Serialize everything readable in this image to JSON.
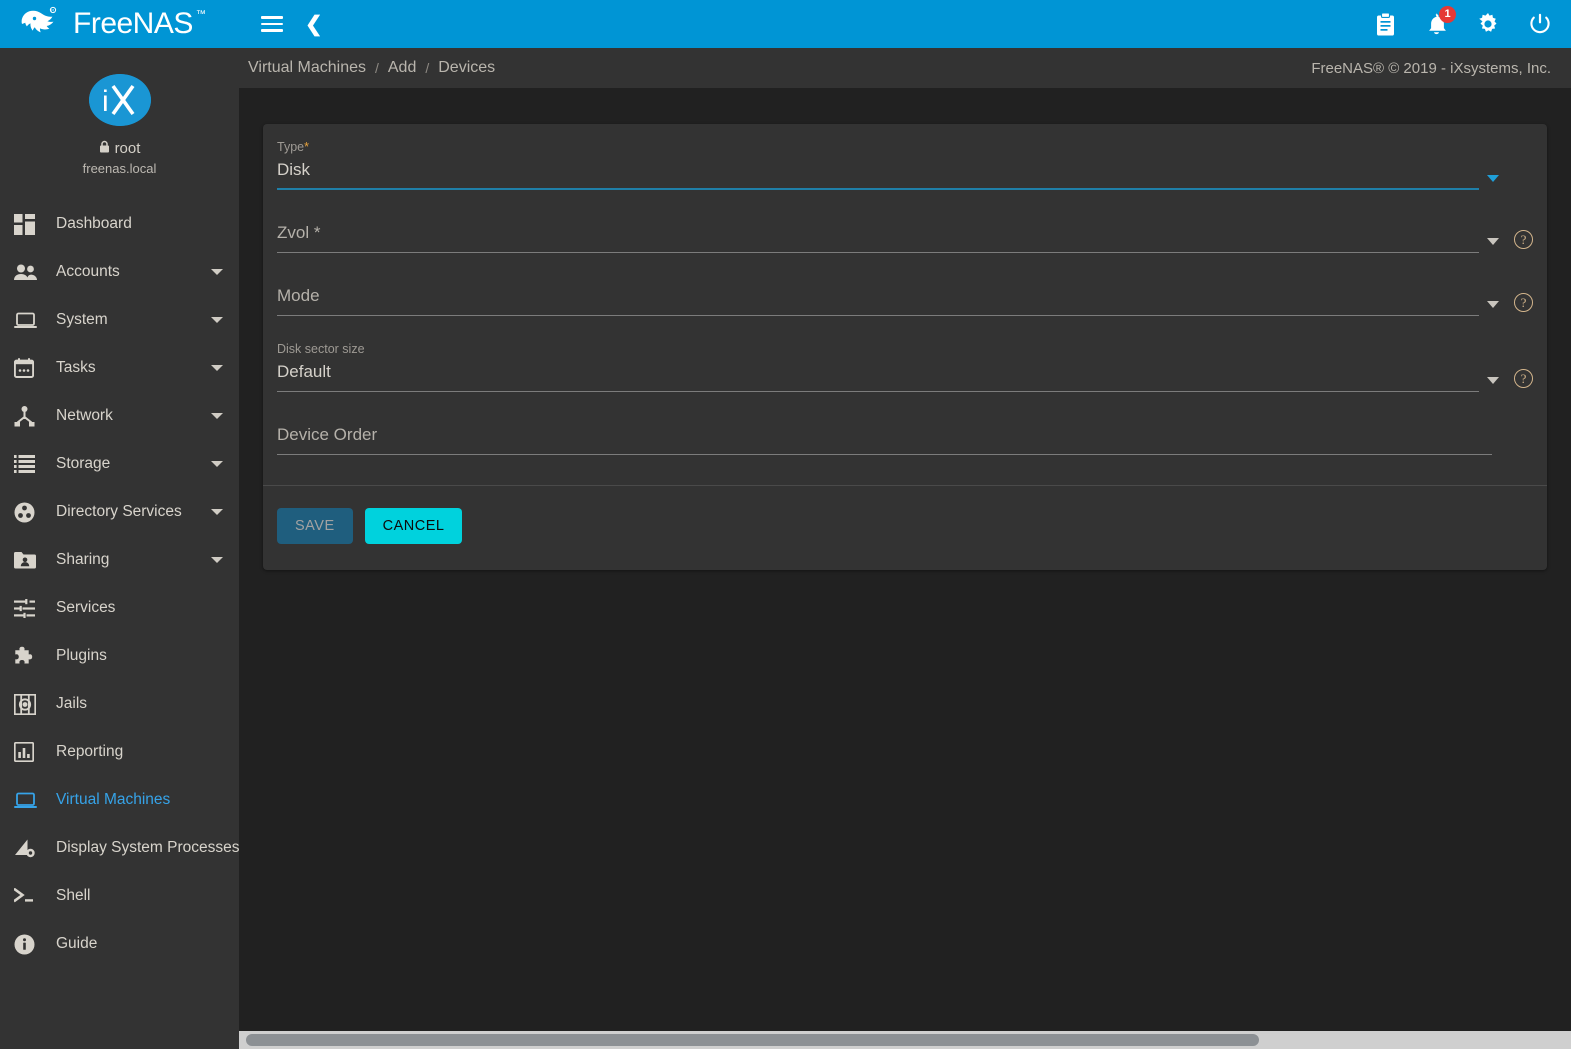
{
  "brand": {
    "name": "FreeNAS",
    "tm": "™",
    "logo_icon": "freenas-fish-logo"
  },
  "sidebar": {
    "user": {
      "avatar_text": "iX",
      "lock_icon": "lock-icon",
      "username": "root",
      "hostname": "freenas.local"
    },
    "items": [
      {
        "label": "Dashboard",
        "icon": "dashboard-icon",
        "expandable": false,
        "active": false
      },
      {
        "label": "Accounts",
        "icon": "accounts-people-icon",
        "expandable": true,
        "active": false
      },
      {
        "label": "System",
        "icon": "system-laptop-icon",
        "expandable": true,
        "active": false
      },
      {
        "label": "Tasks",
        "icon": "tasks-calendar-icon",
        "expandable": true,
        "active": false
      },
      {
        "label": "Network",
        "icon": "network-nodes-icon",
        "expandable": true,
        "active": false
      },
      {
        "label": "Storage",
        "icon": "storage-stack-icon",
        "expandable": true,
        "active": false
      },
      {
        "label": "Directory Services",
        "icon": "directory-services-icon",
        "expandable": true,
        "active": false
      },
      {
        "label": "Sharing",
        "icon": "sharing-folder-icon",
        "expandable": true,
        "active": false
      },
      {
        "label": "Services",
        "icon": "services-sliders-icon",
        "expandable": false,
        "active": false
      },
      {
        "label": "Plugins",
        "icon": "plugins-puzzle-icon",
        "expandable": false,
        "active": false
      },
      {
        "label": "Jails",
        "icon": "jails-icon",
        "expandable": false,
        "active": false
      },
      {
        "label": "Reporting",
        "icon": "reporting-chart-icon",
        "expandable": false,
        "active": false
      },
      {
        "label": "Virtual Machines",
        "icon": "virtual-machines-laptop-icon",
        "expandable": false,
        "active": true
      },
      {
        "label": "Display System Processes",
        "icon": "display-system-processes-icon",
        "expandable": false,
        "active": false
      },
      {
        "label": "Shell",
        "icon": "shell-prompt-icon",
        "expandable": false,
        "active": false
      },
      {
        "label": "Guide",
        "icon": "guide-info-icon",
        "expandable": false,
        "active": false
      }
    ]
  },
  "topbar": {
    "menu_icon": "hamburger-menu-icon",
    "back_icon": "chevron-left-icon",
    "actions": [
      {
        "icon": "clipboard-tasks-icon",
        "badge": null
      },
      {
        "icon": "notifications-bell-icon",
        "badge": "1"
      },
      {
        "icon": "settings-gear-icon",
        "badge": null
      },
      {
        "icon": "power-icon",
        "badge": null
      }
    ]
  },
  "breadcrumb": {
    "items": [
      "Virtual Machines",
      "Add",
      "Devices"
    ],
    "separator": "/"
  },
  "footer": {
    "copyright": "FreeNAS® © 2019 - iXsystems, Inc."
  },
  "form": {
    "fields": [
      {
        "name": "type",
        "label": "Type",
        "required_mark": "*",
        "value": "Disk",
        "state": "filled-focused",
        "has_arrow": true,
        "arrow_color": "#1f9fd8",
        "has_help": false
      },
      {
        "name": "zvol",
        "label": "Zvol *",
        "required_mark": "",
        "value": "",
        "state": "empty",
        "has_arrow": true,
        "arrow_color": "#c9c5be",
        "has_help": true,
        "help_icon": "help-circle-icon"
      },
      {
        "name": "mode",
        "label": "Mode",
        "required_mark": "",
        "value": "",
        "state": "empty",
        "has_arrow": true,
        "arrow_color": "#c9c5be",
        "has_help": true,
        "help_icon": "help-circle-icon"
      },
      {
        "name": "disk-sector-size",
        "label": "Disk sector size",
        "required_mark": "",
        "value": "Default",
        "state": "filled",
        "has_arrow": true,
        "arrow_color": "#c9c5be",
        "has_help": true,
        "help_icon": "help-circle-icon"
      },
      {
        "name": "device-order",
        "label": "Device Order",
        "required_mark": "",
        "value": "",
        "state": "empty",
        "has_arrow": false,
        "arrow_color": "",
        "has_help": false
      }
    ],
    "buttons": {
      "save": "SAVE",
      "cancel": "CANCEL"
    }
  },
  "colors": {
    "brand_blue": "#0095d5",
    "accent_cyan": "#00d2dd",
    "active_nav": "#36a3e8",
    "required_star": "#e8a33d",
    "badge_red": "#e53935",
    "sidebar_bg": "#333333",
    "page_bg": "#212121",
    "card_bg": "#333333",
    "focused_underline": "#1f7fa8",
    "help_icon": "#d3b58c",
    "save_disabled_bg": "#1f5e7e"
  },
  "scrollbar": {
    "orientation": "horizontal",
    "thumb_position": "left"
  }
}
